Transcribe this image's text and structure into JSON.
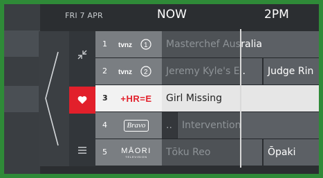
{
  "header": {
    "date": "FRI 7 APR",
    "now_label": "NOW",
    "time_2pm": "2PM"
  },
  "side_icons": {
    "collapse": "collapse-arrows-icon",
    "favourite": "heart-icon",
    "menu": "hamburger-menu-icon"
  },
  "channels": [
    {
      "number": "1",
      "logo": "tvnz 1",
      "programmes": [
        {
          "title": "Masterchef Australia"
        }
      ]
    },
    {
      "number": "2",
      "logo": "tvnz 2",
      "programmes": [
        {
          "title": "Jeremy Kyle's E..."
        },
        {
          "title": "Judge Rin"
        }
      ]
    },
    {
      "number": "3",
      "logo": "+HR=E",
      "programmes": [
        {
          "title": "Girl Missing"
        }
      ]
    },
    {
      "number": "4",
      "logo": "Bravo",
      "programmes": [
        {
          "title": ".."
        },
        {
          "title": "Intervention"
        }
      ]
    },
    {
      "number": "5",
      "logo": "MĀORI",
      "logo_sub": "TELEVISION",
      "programmes": [
        {
          "title": "Tōku Reo"
        },
        {
          "title": "Ōpaki"
        }
      ]
    }
  ],
  "colors": {
    "accent_red": "#e2202b",
    "frame_green": "#2f8a38"
  }
}
